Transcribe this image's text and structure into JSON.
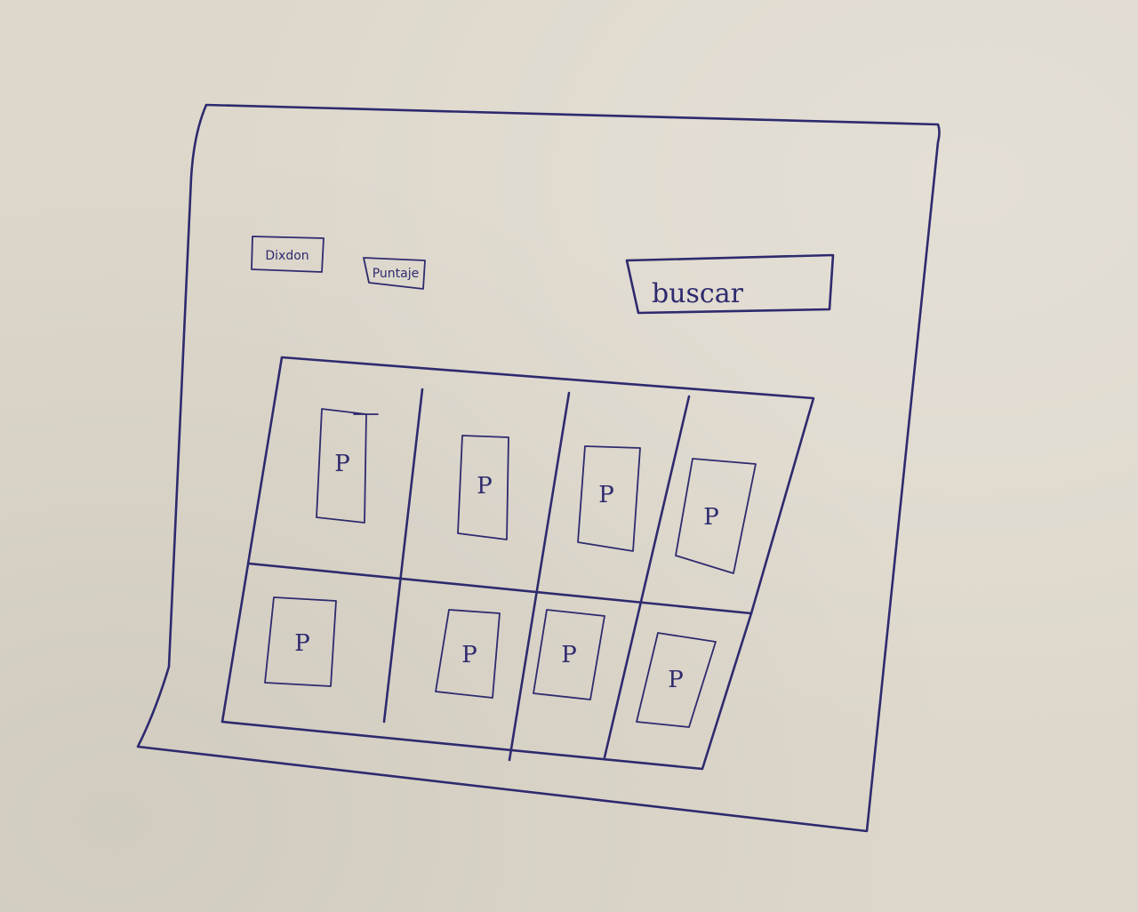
{
  "header": {
    "buttons": [
      {
        "label": "Dixdon"
      },
      {
        "label": "Puntaje"
      }
    ],
    "search": {
      "placeholder": "buscar"
    }
  },
  "grid": {
    "cards": [
      {
        "label": "P"
      },
      {
        "label": "P"
      },
      {
        "label": "P"
      },
      {
        "label": "P"
      },
      {
        "label": "P"
      },
      {
        "label": "P"
      },
      {
        "label": "P"
      },
      {
        "label": "P"
      }
    ]
  },
  "colors": {
    "ink": "#2e2a6e",
    "paper": "#ded8cc"
  }
}
